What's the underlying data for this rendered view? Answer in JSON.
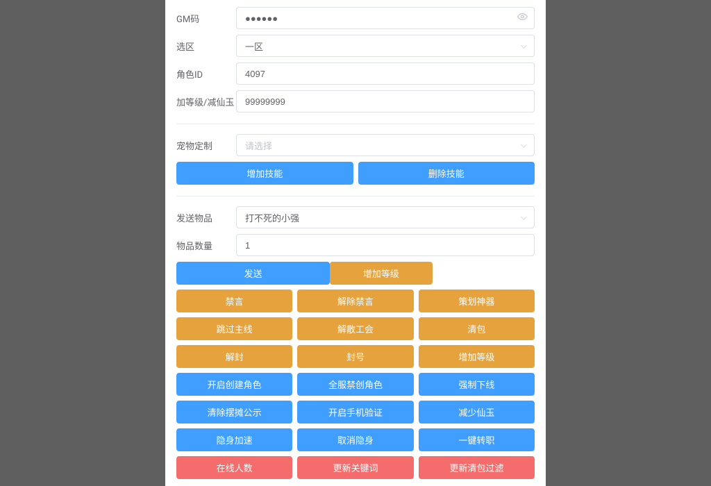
{
  "fields": {
    "gm_code": {
      "label": "GM码",
      "value": "●●●●●●"
    },
    "zone": {
      "label": "选区",
      "value": "一区"
    },
    "role_id": {
      "label": "角色ID",
      "value": "4097"
    },
    "level": {
      "label": "加等级/减仙玉",
      "value": "99999999"
    },
    "pet": {
      "label": "宠物定制",
      "placeholder": "请选择"
    },
    "item": {
      "label": "发送物品",
      "value": "打不死的小强"
    },
    "count": {
      "label": "物品数量",
      "value": "1"
    }
  },
  "skill_buttons": {
    "add": "增加技能",
    "del": "删除技能"
  },
  "send_buttons": {
    "send": "发送",
    "addlv": "增加等级"
  },
  "grid_warning": [
    [
      "禁言",
      "解除禁言",
      "策划神器"
    ],
    [
      "跳过主线",
      "解散工会",
      "清包"
    ],
    [
      "解封",
      "封号",
      "增加等级"
    ]
  ],
  "grid_primary": [
    [
      "开启创建角色",
      "全服禁创角色",
      "强制下线"
    ],
    [
      "清除摆摊公示",
      "开启手机验证",
      "减少仙玉"
    ],
    [
      "隐身加速",
      "取消隐身",
      "一键转职"
    ]
  ],
  "grid_danger": [
    [
      "在线人数",
      "更新关键词",
      "更新清包过滤"
    ]
  ]
}
